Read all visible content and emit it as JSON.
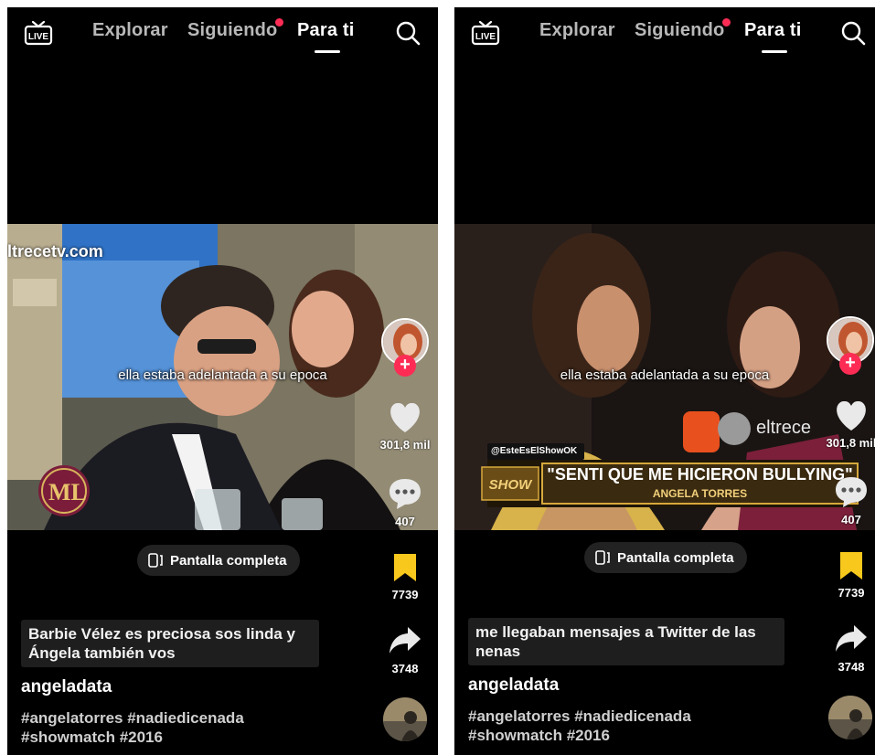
{
  "topbar": {
    "tabs": [
      "Explorar",
      "Siguiendo",
      "Para ti"
    ],
    "active_tab": "Para ti",
    "live_icon": "live-icon",
    "search_icon": "search-icon"
  },
  "posts": [
    {
      "watermark": "ltrecetv.com",
      "logo_text": "ML",
      "caption": "ella estaba adelantada a su epoca",
      "fullscreen_label": "Pantalla completa",
      "likes": "301,8 mil",
      "comments": "407",
      "favorites": "7739",
      "shares": "3748",
      "description": "Barbie Vélez es preciosa sos linda y Ángela también vos",
      "username": "angeladata",
      "hashtags": "#angelatorres #nadiedicenada #showmatch #2016"
    },
    {
      "handle_tag": "@EsteEsElShowOK",
      "banner_title": "\"SENTI QUE ME HICIERON BULLYING\"",
      "banner_subtitle": "ANGELA TORRES",
      "banner_logo": "SHOW",
      "channel_logo": "eltrece",
      "caption": "ella estaba adelantada a su epoca",
      "fullscreen_label": "Pantalla completa",
      "likes": "301,8 mil",
      "comments": "407",
      "favorites": "7739",
      "shares": "3748",
      "description": "me llegaban mensajes a Twitter de las nenas",
      "username": "angeladata",
      "hashtags": "#angelatorres #nadiedicenada #showmatch #2016"
    }
  ],
  "colors": {
    "accent": "#fe2c55",
    "bookmark": "#f8c81c",
    "background": "#000000"
  }
}
